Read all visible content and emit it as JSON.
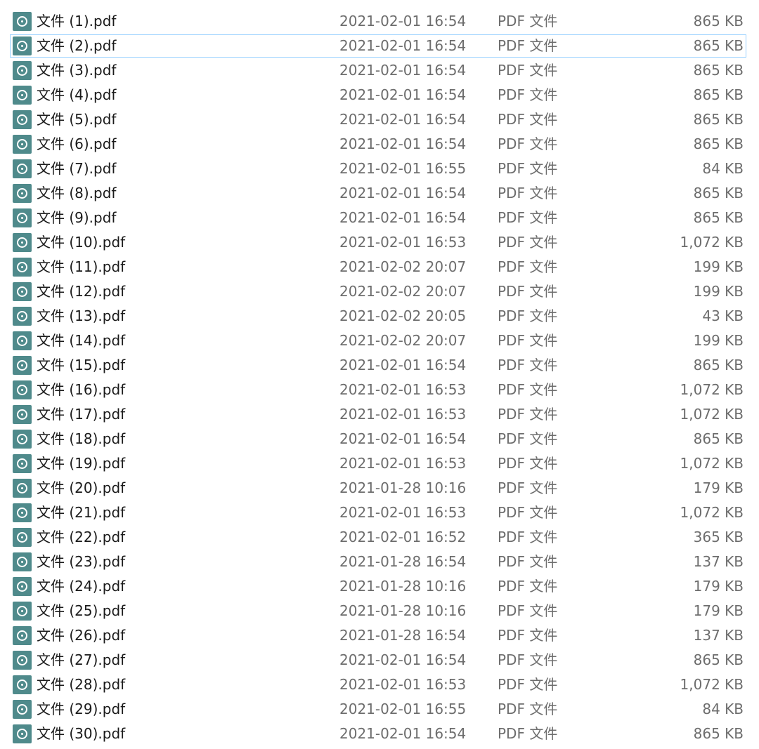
{
  "files": [
    {
      "name": "文件 (1).pdf",
      "date": "2021-02-01 16:54",
      "type": "PDF 文件",
      "size": "865 KB"
    },
    {
      "name": "文件 (2).pdf",
      "date": "2021-02-01 16:54",
      "type": "PDF 文件",
      "size": "865 KB",
      "selected": true
    },
    {
      "name": "文件 (3).pdf",
      "date": "2021-02-01 16:54",
      "type": "PDF 文件",
      "size": "865 KB"
    },
    {
      "name": "文件 (4).pdf",
      "date": "2021-02-01 16:54",
      "type": "PDF 文件",
      "size": "865 KB"
    },
    {
      "name": "文件 (5).pdf",
      "date": "2021-02-01 16:54",
      "type": "PDF 文件",
      "size": "865 KB"
    },
    {
      "name": "文件 (6).pdf",
      "date": "2021-02-01 16:54",
      "type": "PDF 文件",
      "size": "865 KB"
    },
    {
      "name": "文件 (7).pdf",
      "date": "2021-02-01 16:55",
      "type": "PDF 文件",
      "size": "84 KB"
    },
    {
      "name": "文件 (8).pdf",
      "date": "2021-02-01 16:54",
      "type": "PDF 文件",
      "size": "865 KB"
    },
    {
      "name": "文件 (9).pdf",
      "date": "2021-02-01 16:54",
      "type": "PDF 文件",
      "size": "865 KB"
    },
    {
      "name": "文件 (10).pdf",
      "date": "2021-02-01 16:53",
      "type": "PDF 文件",
      "size": "1,072 KB"
    },
    {
      "name": "文件 (11).pdf",
      "date": "2021-02-02 20:07",
      "type": "PDF 文件",
      "size": "199 KB"
    },
    {
      "name": "文件 (12).pdf",
      "date": "2021-02-02 20:07",
      "type": "PDF 文件",
      "size": "199 KB"
    },
    {
      "name": "文件 (13).pdf",
      "date": "2021-02-02 20:05",
      "type": "PDF 文件",
      "size": "43 KB"
    },
    {
      "name": "文件 (14).pdf",
      "date": "2021-02-02 20:07",
      "type": "PDF 文件",
      "size": "199 KB"
    },
    {
      "name": "文件 (15).pdf",
      "date": "2021-02-01 16:54",
      "type": "PDF 文件",
      "size": "865 KB"
    },
    {
      "name": "文件 (16).pdf",
      "date": "2021-02-01 16:53",
      "type": "PDF 文件",
      "size": "1,072 KB"
    },
    {
      "name": "文件 (17).pdf",
      "date": "2021-02-01 16:53",
      "type": "PDF 文件",
      "size": "1,072 KB"
    },
    {
      "name": "文件 (18).pdf",
      "date": "2021-02-01 16:54",
      "type": "PDF 文件",
      "size": "865 KB"
    },
    {
      "name": "文件 (19).pdf",
      "date": "2021-02-01 16:53",
      "type": "PDF 文件",
      "size": "1,072 KB"
    },
    {
      "name": "文件 (20).pdf",
      "date": "2021-01-28 10:16",
      "type": "PDF 文件",
      "size": "179 KB"
    },
    {
      "name": "文件 (21).pdf",
      "date": "2021-02-01 16:53",
      "type": "PDF 文件",
      "size": "1,072 KB"
    },
    {
      "name": "文件 (22).pdf",
      "date": "2021-02-01 16:52",
      "type": "PDF 文件",
      "size": "365 KB"
    },
    {
      "name": "文件 (23).pdf",
      "date": "2021-01-28 16:54",
      "type": "PDF 文件",
      "size": "137 KB"
    },
    {
      "name": "文件 (24).pdf",
      "date": "2021-01-28 10:16",
      "type": "PDF 文件",
      "size": "179 KB"
    },
    {
      "name": "文件 (25).pdf",
      "date": "2021-01-28 10:16",
      "type": "PDF 文件",
      "size": "179 KB"
    },
    {
      "name": "文件 (26).pdf",
      "date": "2021-01-28 16:54",
      "type": "PDF 文件",
      "size": "137 KB"
    },
    {
      "name": "文件 (27).pdf",
      "date": "2021-02-01 16:54",
      "type": "PDF 文件",
      "size": "865 KB"
    },
    {
      "name": "文件 (28).pdf",
      "date": "2021-02-01 16:53",
      "type": "PDF 文件",
      "size": "1,072 KB"
    },
    {
      "name": "文件 (29).pdf",
      "date": "2021-02-01 16:55",
      "type": "PDF 文件",
      "size": "84 KB"
    },
    {
      "name": "文件 (30).pdf",
      "date": "2021-02-01 16:54",
      "type": "PDF 文件",
      "size": "865 KB"
    }
  ],
  "icon": "pdf-file-icon",
  "colors": {
    "icon_bg": "#4f8a8b",
    "selection_border": "#99d1ff",
    "name_text": "#1a1a1a",
    "meta_text": "#6d6d6d"
  }
}
